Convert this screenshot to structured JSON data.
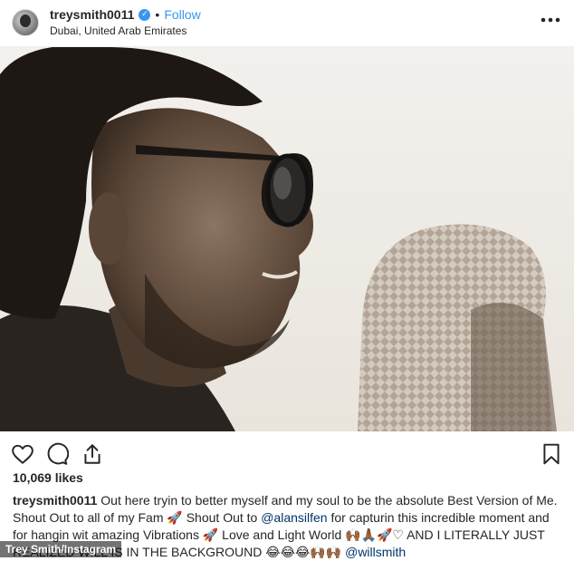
{
  "header": {
    "username": "treysmith0011",
    "verified_glyph": "✓",
    "separator": "•",
    "follow_label": "Follow",
    "location": "Dubai, United Arab Emirates",
    "more_glyph": "• • •"
  },
  "post": {
    "likes": "10,069 likes",
    "caption_user": "treysmith0011",
    "caption_text": " Out here tryin to better myself and my soul to be the absolute Best Version of Me. Shout Out to all of my Fam 🚀 Shout Out to ",
    "mention_1": "@alansilfen",
    "caption_text_2": " for capturin this incredible moment and for hangin wit amazing Vibrations 🚀 Love and Light World 🙌🏾🙏🏾🚀♡ AND I LITERALLY JUST REALIZED WILL IS IN THE BACKGROUND 😂😂😂🙌🏾🙌🏾 ",
    "mention_2": "@willsmith"
  },
  "credit": "Trey Smith/Instagram",
  "icons": {
    "like": "heart-icon",
    "comment": "comment-icon",
    "share": "share-icon",
    "save": "bookmark-icon"
  },
  "colors": {
    "accent": "#3897f0",
    "text": "#262626",
    "mention": "#003569"
  }
}
